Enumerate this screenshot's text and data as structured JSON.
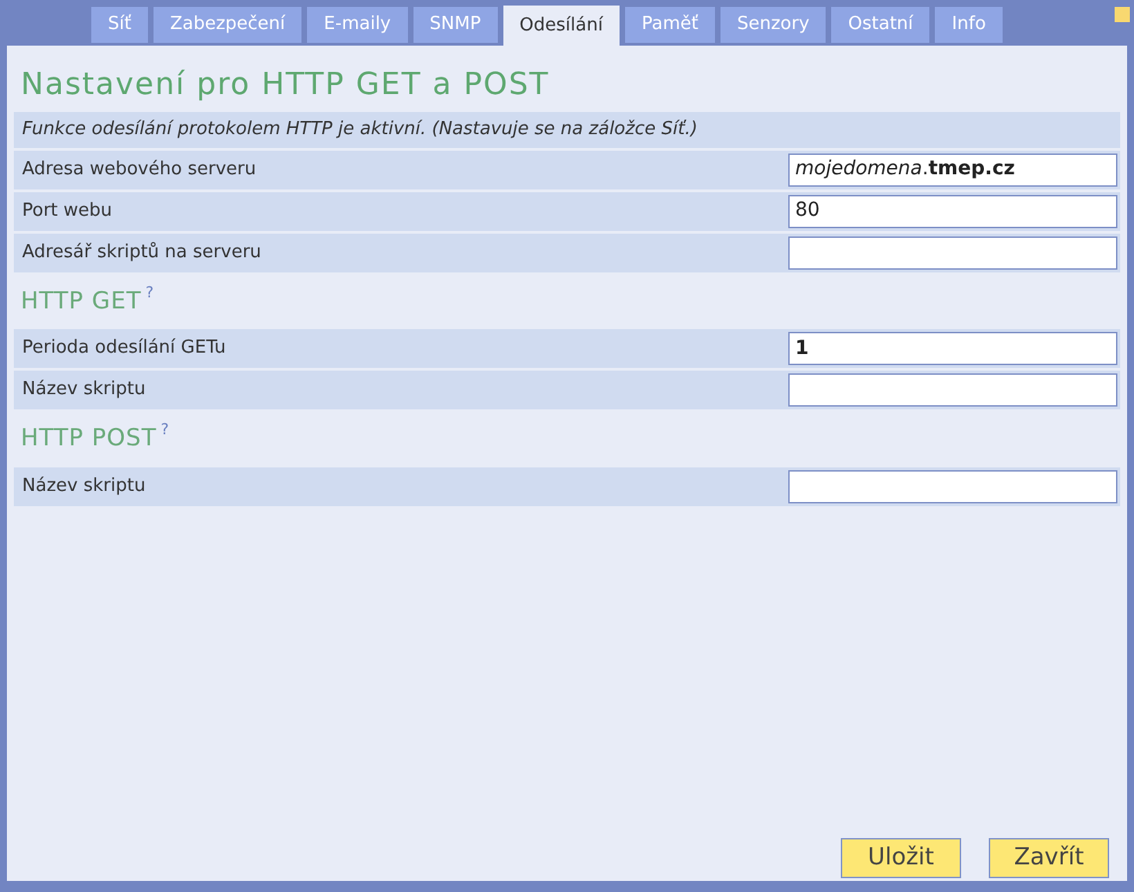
{
  "tabs": [
    {
      "label": "Síť",
      "selected": false
    },
    {
      "label": "Zabezpečení",
      "selected": false
    },
    {
      "label": "E-maily",
      "selected": false
    },
    {
      "label": "SNMP",
      "selected": false
    },
    {
      "label": "Odesílání",
      "selected": true
    },
    {
      "label": "Paměť",
      "selected": false
    },
    {
      "label": "Senzory",
      "selected": false
    },
    {
      "label": "Ostatní",
      "selected": false
    },
    {
      "label": "Info",
      "selected": false
    }
  ],
  "title": "Nastavení pro HTTP GET a POST",
  "notice": "Funkce odesílání protokolem HTTP je aktivní. (Nastavuje se na záložce Síť.)",
  "sections": [
    {
      "rows": [
        {
          "label": "Adresa webového serveru",
          "value": "*mojedomena*.**tmep.cz**"
        },
        {
          "label": "Port webu",
          "value": "80"
        },
        {
          "label": "Adresář skriptů na serveru",
          "value": ""
        }
      ]
    },
    {
      "heading": "HTTP GET",
      "help": "?",
      "rows": [
        {
          "label": "Perioda odesílání GETu",
          "value": "**1**"
        },
        {
          "label": "Název skriptu",
          "value": ""
        }
      ]
    },
    {
      "heading": "HTTP POST",
      "help": "?",
      "rows": [
        {
          "label": "Název skriptu",
          "value": ""
        }
      ]
    }
  ],
  "buttons": [
    "Uložit",
    "Zavřít"
  ]
}
